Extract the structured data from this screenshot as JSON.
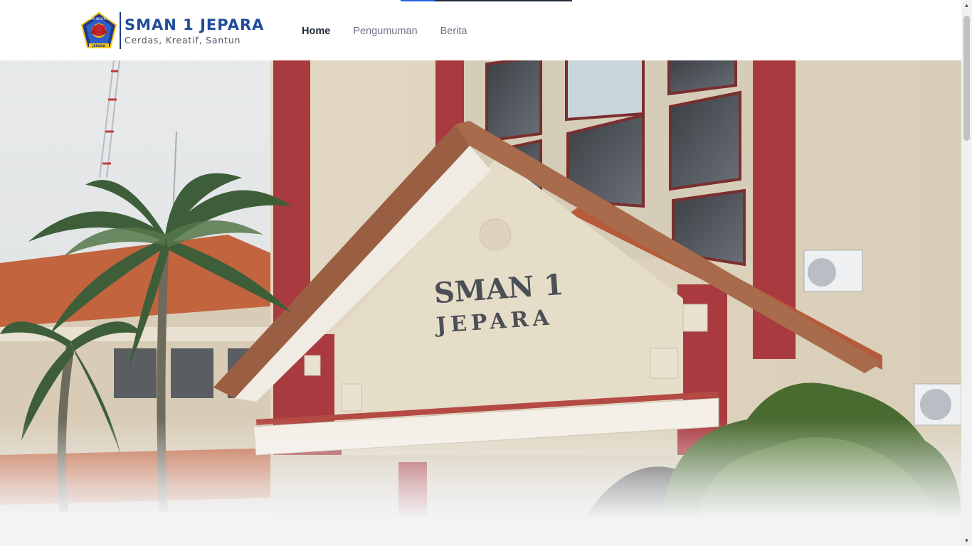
{
  "brand": {
    "name": "SMAN 1 JEPARA",
    "tagline": "Cerdas, Kreatif, Santun",
    "badge_top": "SMA NEGERI 1",
    "badge_bottom": "JEPARA",
    "primary_color": "#1e4d9c"
  },
  "nav": {
    "items": [
      {
        "label": "Home",
        "active": true
      },
      {
        "label": "Pengumuman",
        "active": false
      },
      {
        "label": "Berita",
        "active": false
      }
    ]
  },
  "hero": {
    "sign_line1": "SMAN 1",
    "sign_line2": "JEPARA"
  },
  "icons": {
    "scroll_up": "scroll-up-arrow-icon",
    "scroll_down": "scroll-down-arrow-icon"
  }
}
